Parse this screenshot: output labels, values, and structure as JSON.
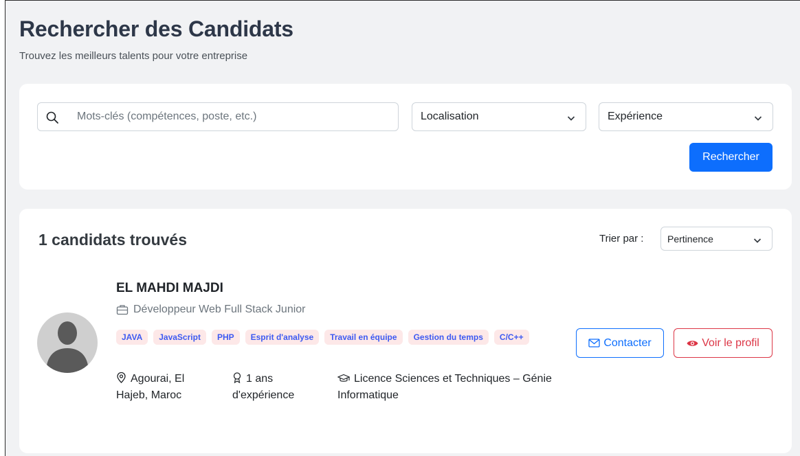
{
  "header": {
    "title": "Rechercher des Candidats",
    "subtitle": "Trouvez les meilleurs talents pour votre entreprise"
  },
  "search": {
    "keywords_placeholder": "Mots-clés (compétences, poste, etc.)",
    "keywords_value": "",
    "location_selected": "Localisation",
    "experience_selected": "Expérience",
    "search_button_label": "Rechercher"
  },
  "results": {
    "count_title": "1 candidats trouvés",
    "sort_label": "Trier par :",
    "sort_selected": "Pertinence",
    "candidates": [
      {
        "name": "EL MAHDI MAJDI",
        "role": "Développeur Web Full Stack Junior",
        "skills": [
          "JAVA",
          "JavaScript",
          "PHP",
          "Esprit d'analyse",
          "Travail en équipe",
          "Gestion du temps",
          "C/C++"
        ],
        "location": "Agourai, El Hajeb, Maroc",
        "experience": "1 ans d'expérience",
        "education": "Licence Sciences et Techniques – Génie Informatique",
        "contact_label": "Contacter",
        "profile_label": "Voir le profil"
      }
    ]
  },
  "colors": {
    "primary": "#0d6efd",
    "danger": "#dc3545",
    "tag_background": "#fde8e8",
    "tag_text": "#3d5af1"
  },
  "icons": {
    "search": "search-icon",
    "chevron": "chevron-down-icon",
    "briefcase": "briefcase-icon",
    "location": "map-pin-icon",
    "experience": "award-icon",
    "education": "graduation-cap-icon",
    "contact": "envelope-icon",
    "profile": "eye-icon",
    "avatar": "avatar-icon"
  }
}
